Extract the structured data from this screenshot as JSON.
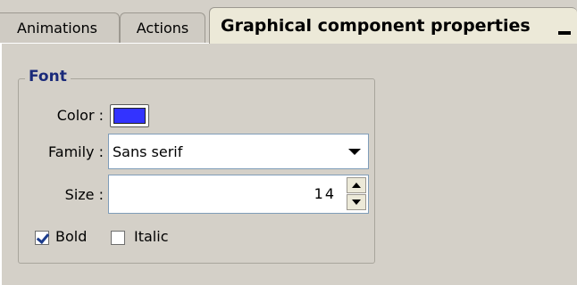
{
  "tabs": [
    {
      "label": "Animations",
      "active": false
    },
    {
      "label": "Actions",
      "active": false
    },
    {
      "label": "Graphical component properties",
      "active": true
    }
  ],
  "group": {
    "title": "Font",
    "color_label": "Color :",
    "color_value": "#3333ff",
    "family_label": "Family :",
    "family_value": "Sans serif",
    "size_label": "Size :",
    "size_value": "14",
    "bold_label": "Bold",
    "bold_checked": true,
    "italic_label": "Italic",
    "italic_checked": false
  },
  "icons": {
    "minimize": "minimize-icon",
    "dropdown": "chevron-down-icon",
    "spin_up": "spin-up-icon",
    "spin_down": "spin-down-icon",
    "check": "checkmark-icon"
  },
  "colors": {
    "panel_bg": "#d4d0c8",
    "active_tab_bg": "#ece9d8",
    "legend_text": "#1a2a7a",
    "input_border": "#7f9db9"
  }
}
